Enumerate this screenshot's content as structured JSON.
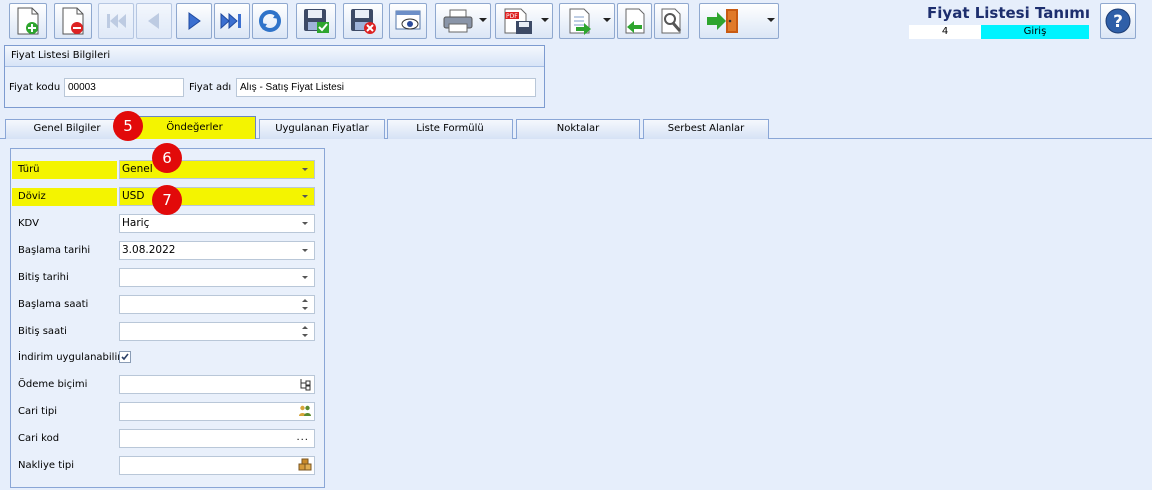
{
  "window": {
    "title": "Fiyat Listesi Tanımı",
    "record_no": "4",
    "mode": "Giriş"
  },
  "toolbar": {
    "icons": [
      "new-icon",
      "delete-icon",
      "first-icon",
      "previous-icon",
      "next-icon",
      "last-icon",
      "refresh-icon",
      "save-icon",
      "cancel-icon",
      "preview-icon",
      "print-icon",
      "pdf-icon",
      "export-icon",
      "back-icon",
      "tools-icon",
      "exit-icon",
      "help-icon"
    ]
  },
  "header_group": {
    "title": "Fiyat Listesi Bilgileri",
    "code_label": "Fiyat kodu",
    "code_value": "00003",
    "name_label": "Fiyat adı",
    "name_value": "Alış - Satış Fiyat Listesi"
  },
  "tabs": [
    {
      "label": "Genel Bilgiler",
      "active": false
    },
    {
      "label": "Öndeğerler",
      "active": true
    },
    {
      "label": "Uygulanan Fiyatlar",
      "active": false
    },
    {
      "label": "Liste Formülü",
      "active": false
    },
    {
      "label": "Noktalar",
      "active": false
    },
    {
      "label": "Serbest Alanlar",
      "active": false
    }
  ],
  "form": {
    "turu": {
      "label": "Türü",
      "value": "Genel"
    },
    "doviz": {
      "label": "Döviz",
      "value": "USD"
    },
    "kdv": {
      "label": "KDV",
      "value": "Hariç"
    },
    "baslama_tarihi": {
      "label": "Başlama tarihi",
      "value": "3.08.2022"
    },
    "bitis_tarihi": {
      "label": "Bitiş tarihi",
      "value": ""
    },
    "baslama_saati": {
      "label": "Başlama saati",
      "value": ""
    },
    "bitis_saati": {
      "label": "Bitiş saati",
      "value": ""
    },
    "indirim": {
      "label": "İndirim uygulanabilir",
      "checked": true
    },
    "odeme_bicimi": {
      "label": "Ödeme biçimi",
      "value": ""
    },
    "cari_tipi": {
      "label": "Cari tipi",
      "value": ""
    },
    "cari_kod": {
      "label": "Cari kod",
      "value": "",
      "button": "..."
    },
    "nakliye_tipi": {
      "label": "Nakliye tipi",
      "value": ""
    }
  },
  "annotations": [
    "5",
    "6",
    "7"
  ],
  "colors": {
    "highlight": "#f4f400",
    "badge": "#e20a0a",
    "mode": "#00f3ff",
    "title": "#1d2e6e"
  }
}
